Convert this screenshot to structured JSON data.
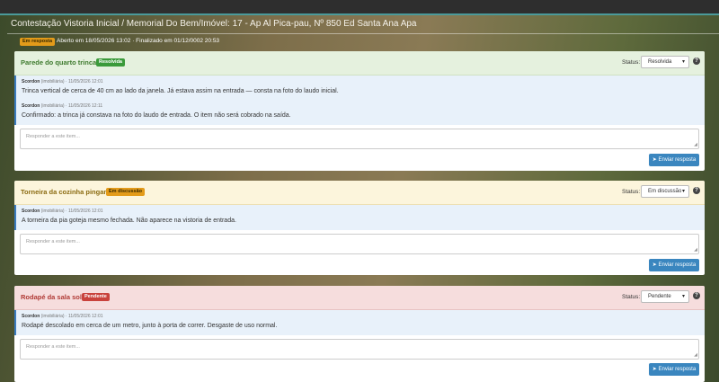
{
  "page": {
    "title": "Contestação Vistoria Inicial / Memorial Do Bem/Imóvel: 17 - Ap Al Pica-pau, Nº 850 Ed Santa Ana Apa",
    "status_badge": "Em resposta",
    "meta_text": "Aberto em 18/05/2026 13:02 · Finalizado em 01/12/0002 20:53"
  },
  "labels": {
    "status": "Status:",
    "reply_placeholder": "Responder a este item...",
    "send_button": "Enviar resposta",
    "help": "?"
  },
  "colors": {
    "resolved_bg": "#e5f1de",
    "discussion_bg": "#fcf5dc",
    "pending_bg": "#f6dddd",
    "accent": "#3a86bf"
  },
  "items": [
    {
      "title": "Parede do quarto trincada",
      "badge": "Resolvida",
      "status_value": "Resolvida",
      "messages": [
        {
          "author": "Scordon",
          "role": "(imobiliária)",
          "date": "· 11/05/2026 12:01",
          "text": "Trinca vertical de cerca de 40 cm ao lado da janela. Já estava assim na entrada — consta na foto do laudo inicial."
        },
        {
          "author": "Scordon",
          "role": "(imobiliária)",
          "date": "· 11/05/2026 12:11",
          "text": "Confirmado: a trinca já constava na foto do laudo de entrada. O item não será cobrado na saída."
        }
      ]
    },
    {
      "title": "Torneira da cozinha pingando",
      "badge": "Em discussão",
      "status_value": "Em discussão",
      "messages": [
        {
          "author": "Scordon",
          "role": "(imobiliária)",
          "date": "· 11/05/2026 12:01",
          "text": "A torneira da pia goteja mesmo fechada. Não aparece na vistoria de entrada."
        }
      ]
    },
    {
      "title": "Rodapé da sala solto",
      "badge": "Pendente",
      "status_value": "Pendente",
      "messages": [
        {
          "author": "Scordon",
          "role": "(imobiliária)",
          "date": "· 11/05/2026 12:01",
          "text": "Rodapé descolado em cerca de um metro, junto à porta de correr. Desgaste de uso normal."
        }
      ]
    }
  ]
}
